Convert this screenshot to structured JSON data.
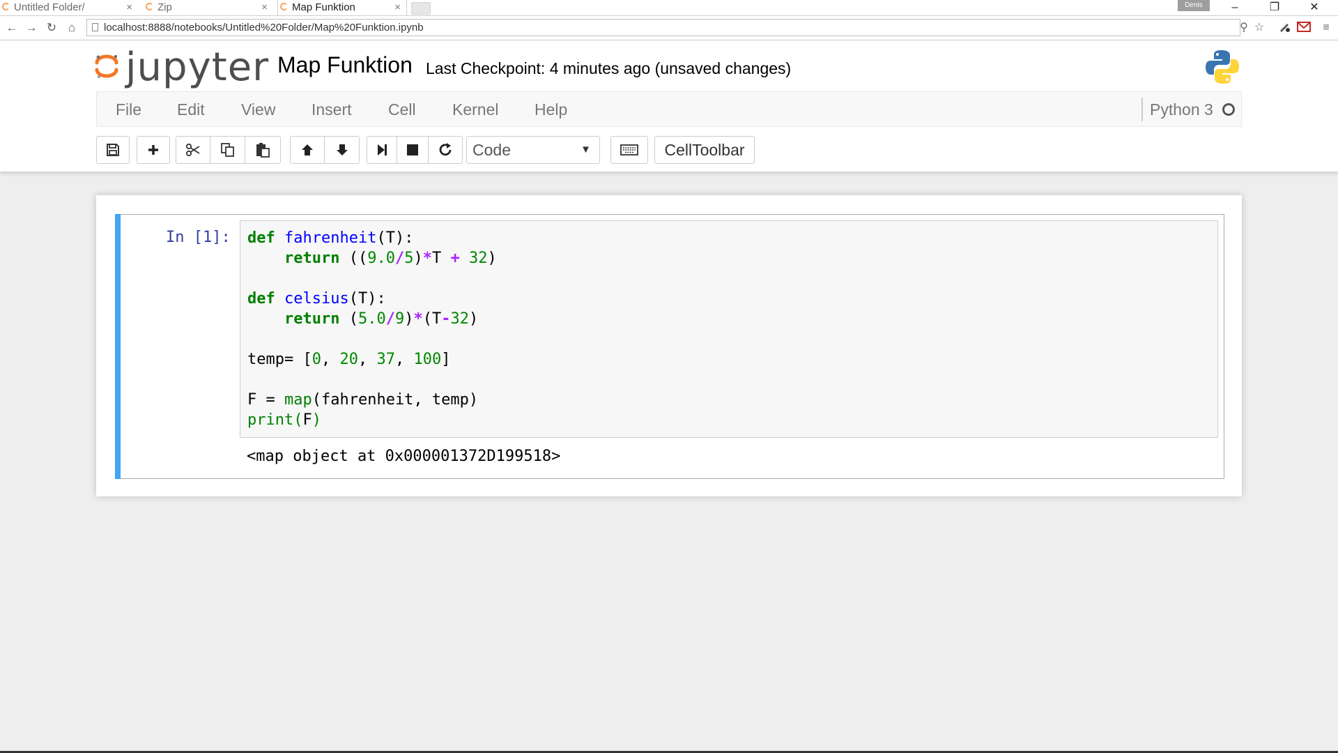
{
  "browser": {
    "tabs": [
      {
        "title": "Untitled Folder/",
        "close": "×"
      },
      {
        "title": "Zip",
        "close": "×"
      },
      {
        "title": "Map Funktion",
        "close": "×"
      }
    ],
    "user_badge": "Denis",
    "window_buttons": {
      "minimize": "–",
      "restore": "❐",
      "close": "✕"
    },
    "url": "localhost:8888/notebooks/Untitled%20Folder/Map%20Funktion.ipynb",
    "nav": {
      "back": "←",
      "forward": "→",
      "reload": "↻",
      "home": "⌂"
    },
    "addr_icons": {
      "zoom": "⚲",
      "star": "☆",
      "menu": "≡"
    }
  },
  "header": {
    "logo_text": "jupyter",
    "notebook_name": "Map Funktion",
    "checkpoint": "Last Checkpoint: 4 minutes ago (unsaved changes)"
  },
  "menu": {
    "file": "File",
    "edit": "Edit",
    "view": "View",
    "insert": "Insert",
    "cell": "Cell",
    "kernel": "Kernel",
    "help": "Help",
    "kernel_name": "Python 3"
  },
  "toolbar": {
    "cell_type": "Code",
    "caret": "▼",
    "celltoolbar": "CellToolbar"
  },
  "cell": {
    "prompt": "In [1]:",
    "code": {
      "l1_kw": "def",
      "l1_fn": "fahrenheit",
      "l1_rest": "(T):",
      "l2_kw": "return",
      "l2_a": " ((",
      "l2_n1": "9.0",
      "l2_o1": "/",
      "l2_n2": "5",
      "l2_b": ")",
      "l2_o2": "*",
      "l2_c": "T ",
      "l2_o3": "+",
      "l2_d": " ",
      "l2_n3": "32",
      "l2_e": ")",
      "l4_kw": "def",
      "l4_fn": "celsius",
      "l4_rest": "(T):",
      "l5_kw": "return",
      "l5_a": " (",
      "l5_n1": "5.0",
      "l5_o1": "/",
      "l5_n2": "9",
      "l5_b": ")",
      "l5_o2": "*",
      "l5_c": "(T",
      "l5_o3": "-",
      "l5_n3": "32",
      "l5_d": ")",
      "l7_a": "temp= [",
      "l7_n1": "0",
      "l7_s1": ", ",
      "l7_n2": "20",
      "l7_s2": ", ",
      "l7_n3": "37",
      "l7_s3": ", ",
      "l7_n4": "100",
      "l7_b": "]",
      "l9_a": "F = ",
      "l9_bi": "map",
      "l9_b": "(fahrenheit, temp)",
      "l10_bi": "print",
      "l10_p1": "(",
      "l10_b": "F",
      "l10_p2": ")"
    },
    "output": "<map object at 0x000001372D199518>"
  },
  "colors": {
    "cell_marker": "#42a5f5",
    "prompt": "#303f9f",
    "keyword": "#008000",
    "function": "#0000ff",
    "operator": "#aa22ff",
    "logo_orange": "#f37726"
  },
  "icons": {
    "save": "save-icon",
    "insert": "plus-icon",
    "cut": "scissors-icon",
    "copy": "copy-icon",
    "paste": "paste-icon",
    "up": "arrow-up-icon",
    "down": "arrow-down-icon",
    "run": "step-forward-icon",
    "stop": "stop-icon",
    "restart": "restart-icon",
    "keyboard": "keyboard-icon"
  }
}
